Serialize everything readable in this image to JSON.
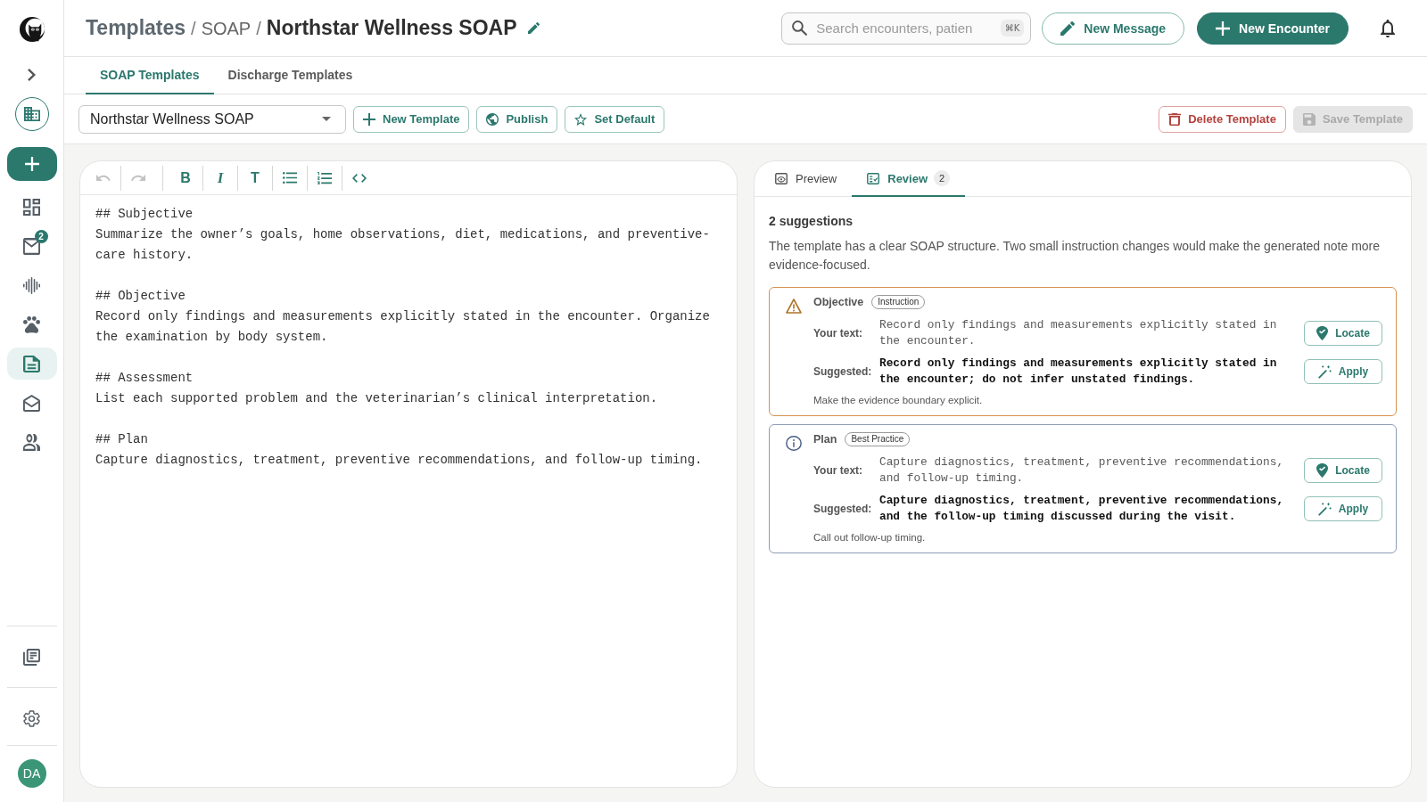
{
  "sidebar": {
    "items": [
      {
        "selected": false
      },
      {
        "selected": false,
        "badge": "2"
      },
      {
        "selected": false
      },
      {
        "selected": false
      },
      {
        "selected": true
      },
      {
        "selected": false
      },
      {
        "selected": false
      }
    ],
    "avatar": "DA"
  },
  "header": {
    "breadcrumb": [
      {
        "kind": "root",
        "text": "Templates"
      },
      {
        "kind": "separator",
        "text": "/"
      },
      {
        "kind": "link",
        "text": "SOAP"
      },
      {
        "kind": "separator",
        "text": "/"
      },
      {
        "kind": "current",
        "text": "Northstar Wellness SOAP"
      }
    ],
    "search": {
      "placeholder": "Search encounters, patien",
      "shortcut": "⌘K"
    },
    "buttons": [
      {
        "kind": "outline",
        "label": "New Message"
      },
      {
        "kind": "primary",
        "label": "New Encounter"
      }
    ]
  },
  "tabs": [
    {
      "label": "SOAP Templates",
      "selected": true
    },
    {
      "label": "Discharge Templates",
      "selected": false
    }
  ],
  "toolbar": {
    "template_select": {
      "value": "Northstar Wellness SOAP"
    },
    "actions": [
      {
        "label": "New Template"
      },
      {
        "label": "Publish"
      },
      {
        "label": "Set Default"
      }
    ],
    "right_actions": [
      {
        "kind": "danger",
        "label": "Delete Template",
        "disabled": false
      },
      {
        "kind": "primary",
        "label": "Save Template",
        "disabled": true
      }
    ]
  },
  "editor": {
    "tools": [
      {
        "kind": "icon",
        "disabled": true
      },
      {
        "kind": "icon",
        "disabled": true
      },
      {
        "kind": "glyph",
        "label": "B",
        "disabled": false
      },
      {
        "kind": "glyph",
        "label": "I",
        "disabled": false
      },
      {
        "kind": "glyph",
        "label": "T",
        "disabled": false
      },
      {
        "kind": "icon",
        "disabled": false
      },
      {
        "kind": "icon",
        "disabled": false
      },
      {
        "kind": "icon",
        "disabled": false
      }
    ],
    "blocks": [
      {
        "kind": "heading",
        "text": "## Subjective"
      },
      {
        "kind": "paragraph",
        "text": "Summarize the owner’s goals, home observations, diet, medications, and preventive-care history."
      },
      {
        "kind": "heading",
        "text": "## Objective"
      },
      {
        "kind": "paragraph",
        "text": "Record only findings and measurements explicitly stated in the encounter. Organize the examination by body system."
      },
      {
        "kind": "heading",
        "text": "## Assessment"
      },
      {
        "kind": "paragraph",
        "text": "List each supported problem and the veterinarian’s clinical interpretation."
      },
      {
        "kind": "heading",
        "text": "## Plan"
      },
      {
        "kind": "paragraph",
        "text": "Capture diagnostics, treatment, preventive recommendations, and follow-up timing."
      }
    ]
  },
  "review_panel": {
    "tabs": [
      {
        "label": "Preview",
        "selected": false
      },
      {
        "label": "Review",
        "selected": true,
        "count": "2"
      }
    ],
    "heading": "2 suggestions",
    "summary": "The template has a clear SOAP structure. Two small instruction changes would make the generated note more evidence-focused.",
    "suggestions": [
      {
        "kind": "warning",
        "section": "Objective",
        "tag": "Instruction",
        "your_text_label": "Your text:",
        "your_text": "Record only findings and measurements explicitly stated in the encounter.",
        "suggested_label": "Suggested:",
        "suggested": "Record only findings and measurements explicitly stated in the encounter; do not infer unstated findings.",
        "note": "Make the evidence boundary explicit.",
        "actions": [
          {
            "label": "Locate"
          },
          {
            "label": "Apply"
          }
        ]
      },
      {
        "kind": "info",
        "section": "Plan",
        "tag": "Best Practice",
        "your_text_label": "Your text:",
        "your_text": "Capture diagnostics, treatment, preventive recommendations, and follow-up timing.",
        "suggested_label": "Suggested:",
        "suggested": "Capture diagnostics, treatment, preventive recommendations, and the follow-up timing discussed during the visit.",
        "note": "Call out follow-up timing.",
        "actions": [
          {
            "label": "Locate"
          },
          {
            "label": "Apply"
          }
        ]
      }
    ]
  }
}
